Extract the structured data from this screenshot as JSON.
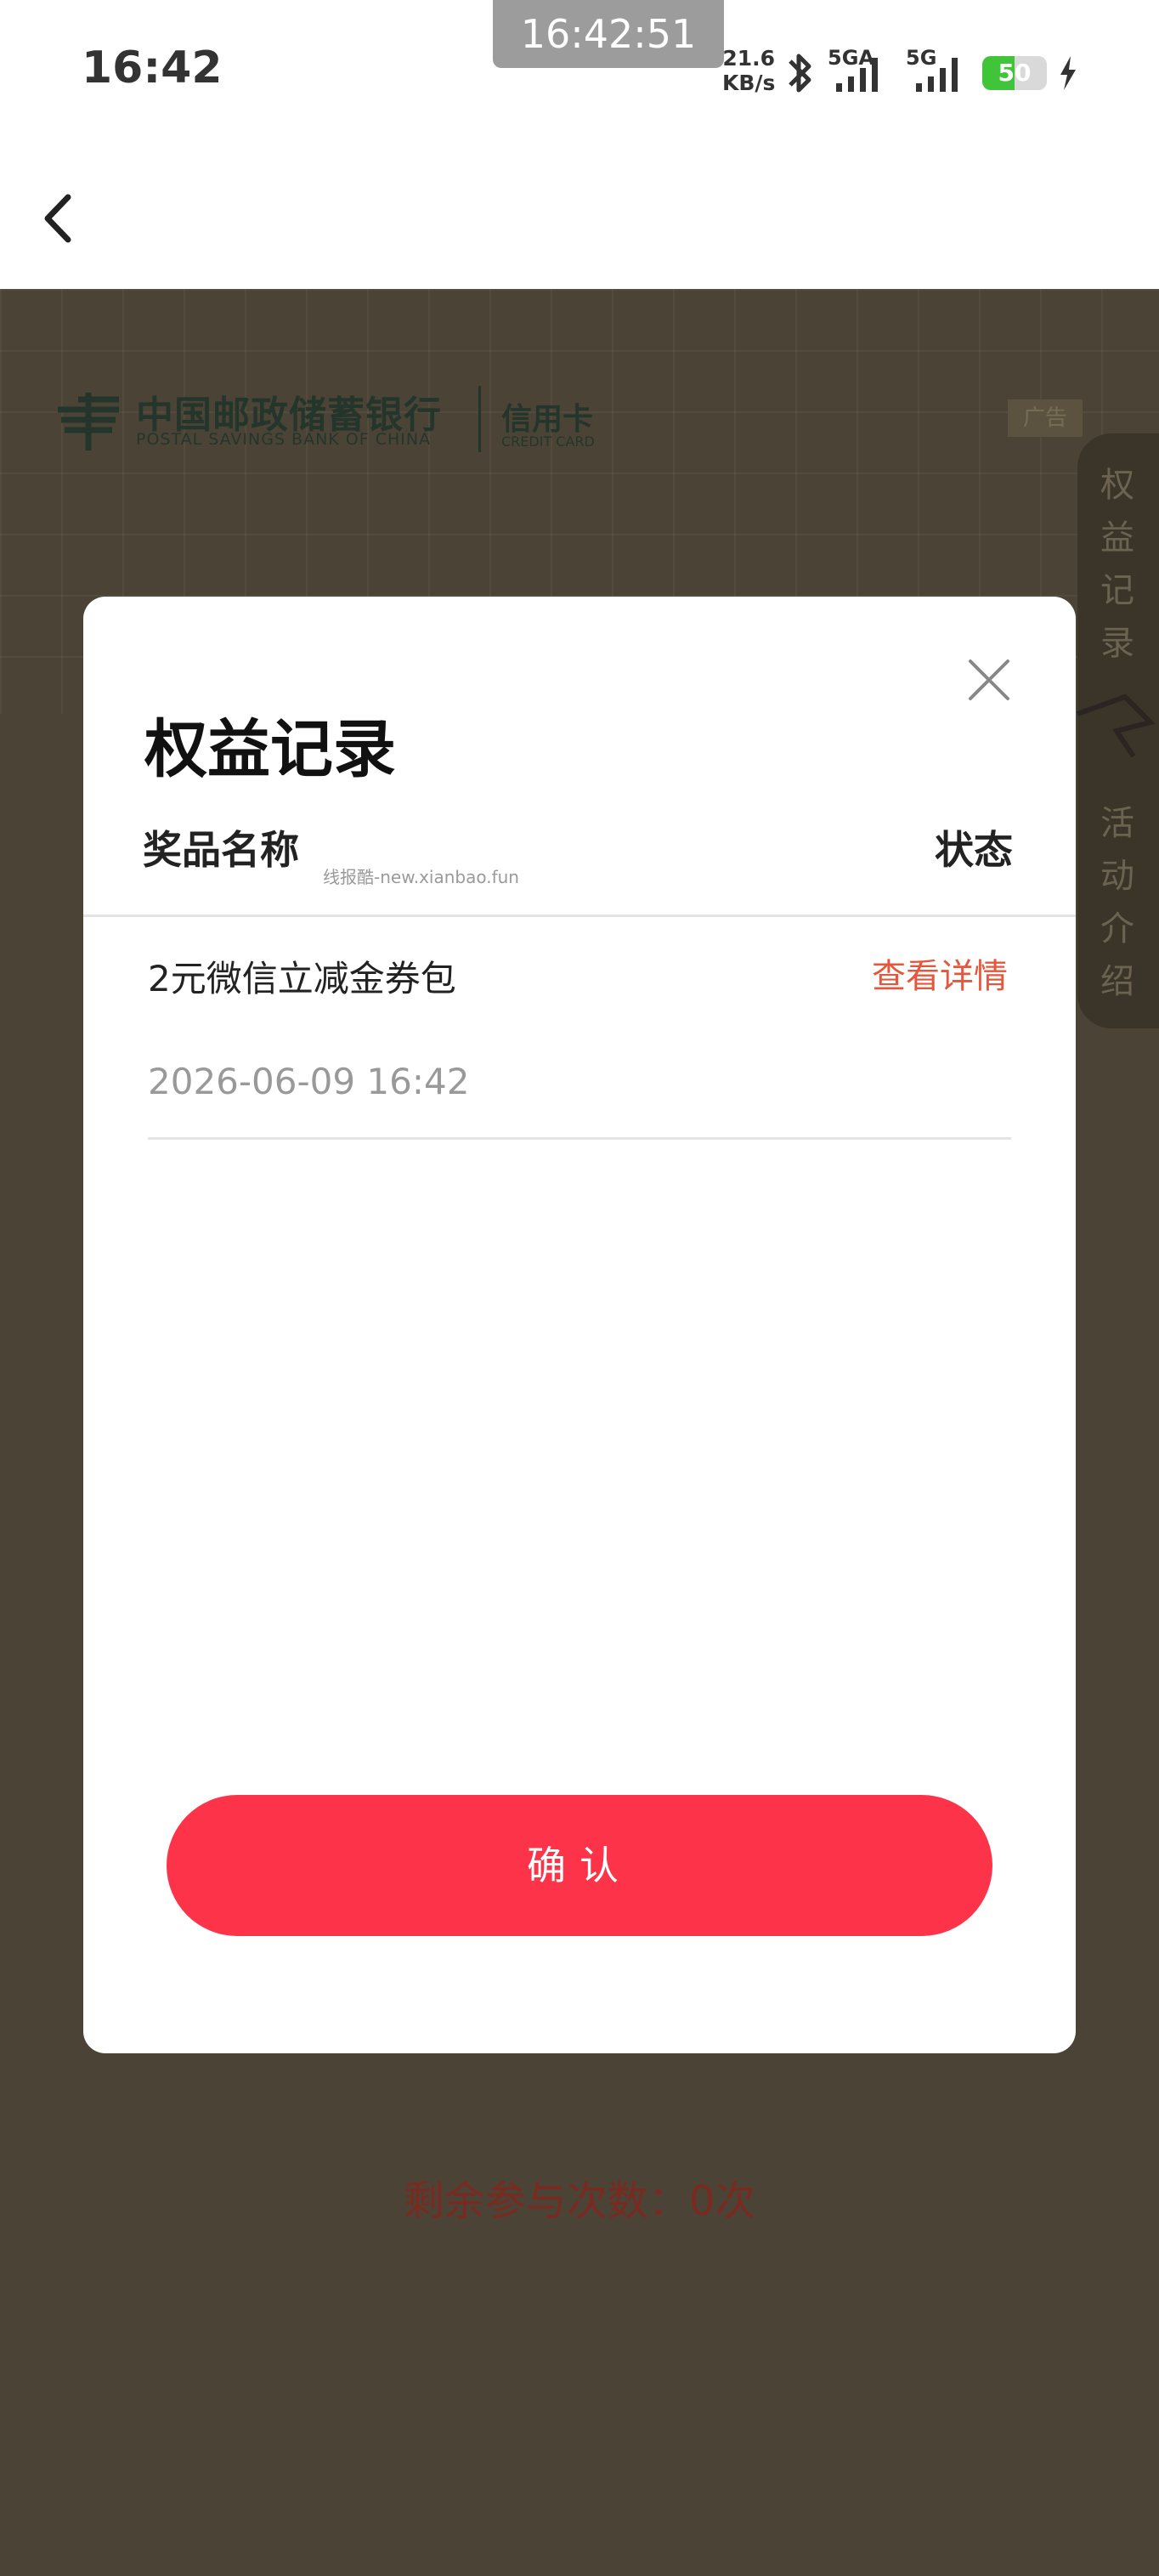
{
  "status_bar": {
    "time": "16:42",
    "screenshot_time": "16:42:51",
    "net_speed_value": "21.6",
    "net_speed_unit": "KB/s",
    "signal1_label": "5GA",
    "signal2_label": "5G",
    "battery_level": "50",
    "battery_fraction": 0.5,
    "icons": [
      "bluetooth-icon",
      "signal-icon",
      "charging-icon"
    ]
  },
  "nav": {
    "back_icon": "chevron-left-icon"
  },
  "background": {
    "bank_name_cn": "中国邮政储蓄银行",
    "bank_name_en": "POSTAL SAVINGS BANK OF CHINA",
    "credit_card_cn": "信用卡",
    "credit_card_en": "CREDIT CARD",
    "ad_label": "广告",
    "side_tabs": [
      "权益记录",
      "活动介绍"
    ],
    "remaining_text": "剩余参与次数：0次"
  },
  "modal": {
    "title": "权益记录",
    "column_name": "奖品名称",
    "column_status": "状态",
    "watermark": "线报酷-new.xianbao.fun",
    "records": [
      {
        "name": "2元微信立减金券包",
        "action": "查看详情",
        "time": "2026-06-09 16:42"
      }
    ],
    "confirm_label": "确认"
  },
  "colors": {
    "accent_red": "#fd3349",
    "link_orange": "#e5573d",
    "overlay_bg": "#4b4436",
    "battery_green": "#3fc43a"
  }
}
